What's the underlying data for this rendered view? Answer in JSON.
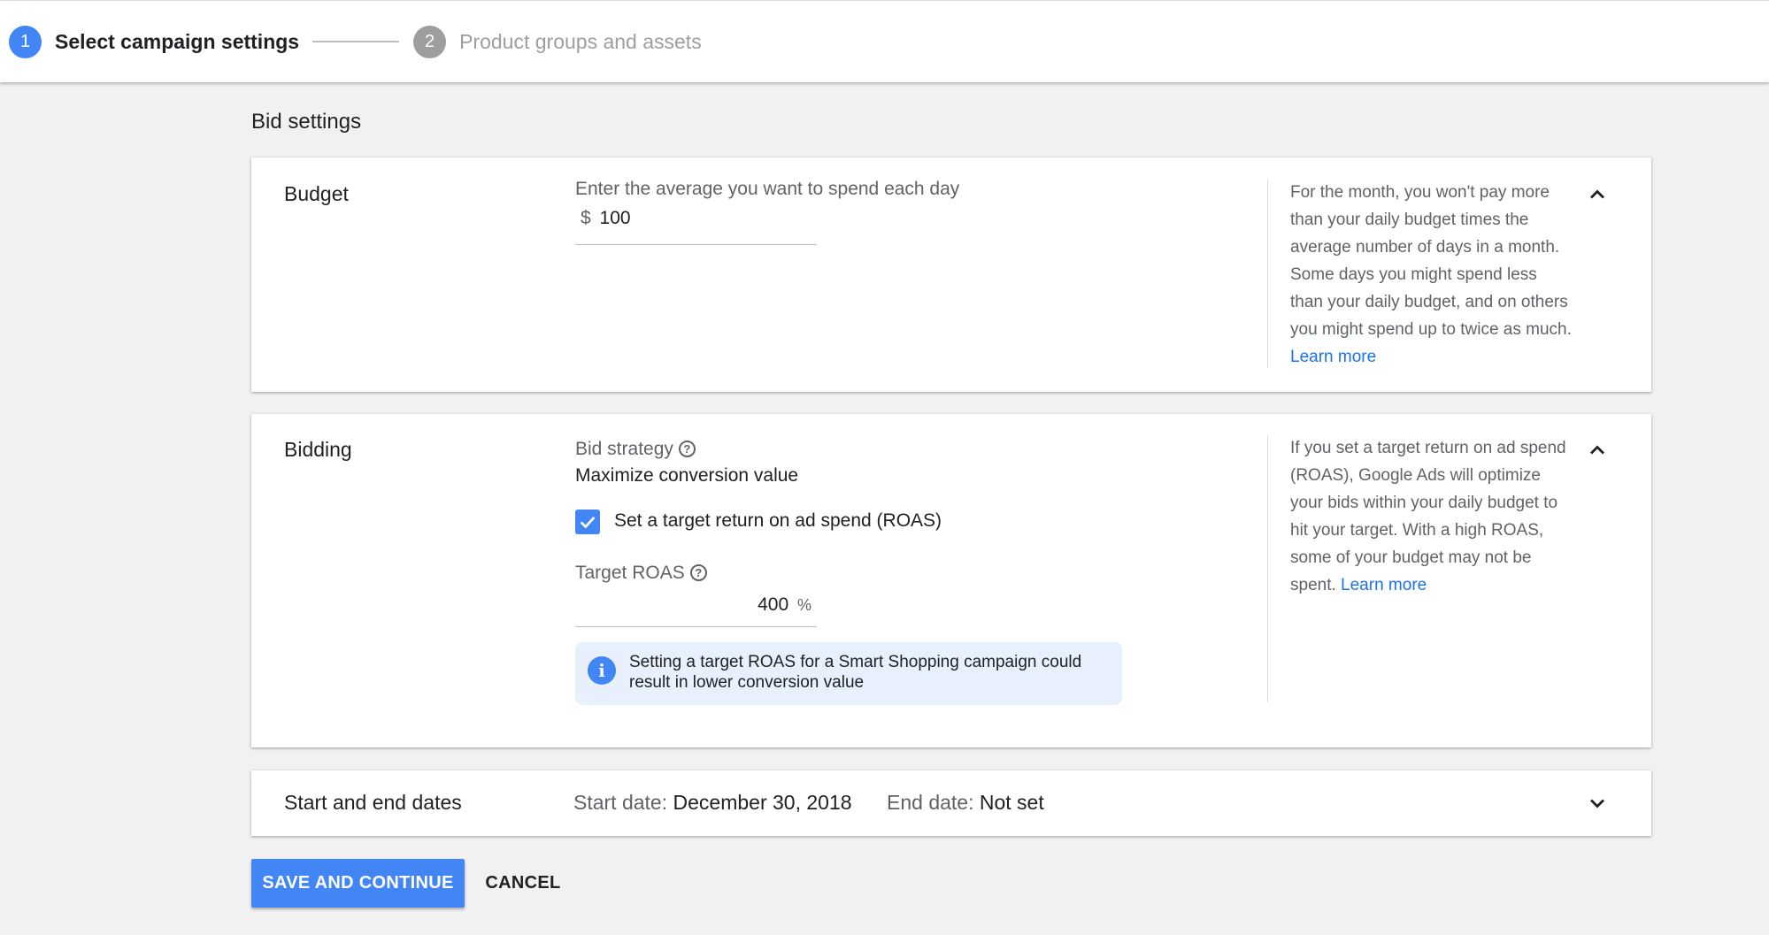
{
  "stepper": {
    "step1": {
      "number": "1",
      "label": "Select campaign settings"
    },
    "step2": {
      "number": "2",
      "label": "Product groups and assets"
    }
  },
  "section_title": "Bid settings",
  "budget": {
    "label": "Budget",
    "prompt": "Enter the average you want to spend each day",
    "currency": "$",
    "value": "100",
    "help": "For the month, you won't pay more than your daily budget times the average number of days in a month. Some days you might spend less than your daily budget, and on others you might spend up to twice as much.",
    "help_link": "Learn more"
  },
  "bidding": {
    "label": "Bidding",
    "strategy_label": "Bid strategy",
    "strategy_value": "Maximize conversion value",
    "checkbox_label": "Set a target return on ad spend (ROAS)",
    "checkbox_checked": true,
    "target_roas_label": "Target ROAS",
    "target_roas_value": "400",
    "target_roas_unit": "%",
    "info": "Setting a target ROAS for a Smart Shopping campaign could result in lower conversion value",
    "help": "If you set a target return on ad spend (ROAS), Google Ads will optimize your bids within your daily budget to hit your target. With a high ROAS, some of your budget may not be spent.",
    "help_link": "Learn more"
  },
  "dates": {
    "label": "Start and end dates",
    "start_label": "Start date:",
    "start_value": "December 30, 2018",
    "end_label": "End date:",
    "end_value": "Not set"
  },
  "actions": {
    "save": "SAVE AND CONTINUE",
    "cancel": "CANCEL"
  },
  "colors": {
    "accent": "#4285f4",
    "link": "#1a73e8",
    "info_bg": "#e8f0fe"
  },
  "icons": [
    "question-icon",
    "check-icon",
    "info-icon",
    "chevron-up-icon",
    "chevron-down-icon"
  ]
}
